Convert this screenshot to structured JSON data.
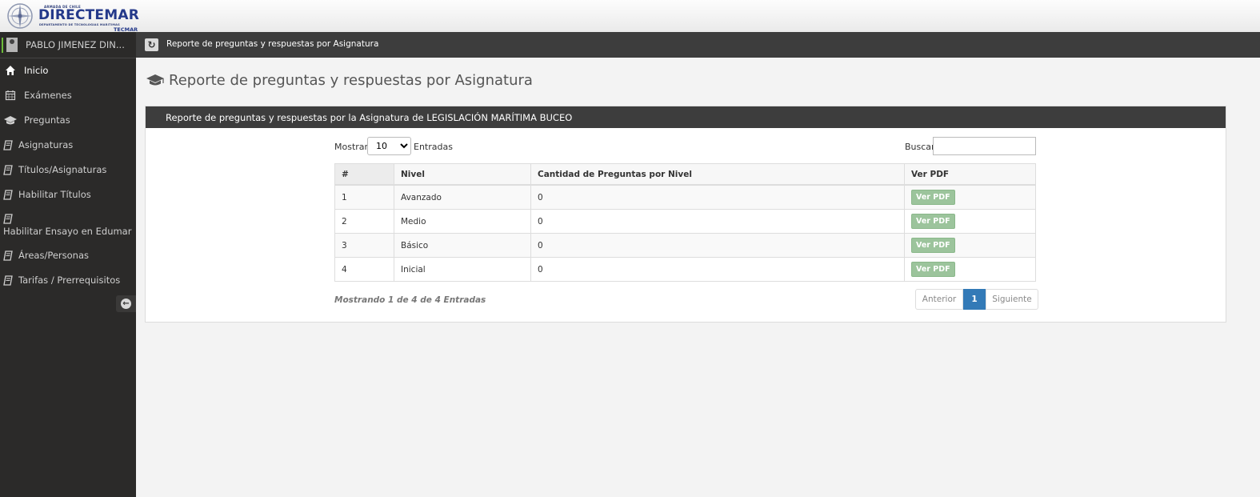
{
  "logo": {
    "top_text": "ARMADA DE CHILE",
    "brand": "DIRECTEMAR",
    "department": "DEPARTAMENTO DE TECNOLOGIAS MARITIMAS",
    "suffix": "TECMAR"
  },
  "user": {
    "name": "PABLO JIMENEZ DIN..."
  },
  "sidebar": {
    "items": [
      {
        "label": "Inicio",
        "icon": "home-icon",
        "active": true
      },
      {
        "label": "Exámenes",
        "icon": "calendar-icon"
      },
      {
        "label": "Preguntas",
        "icon": "graduation-cap-icon"
      },
      {
        "label": "Asignaturas",
        "icon": "book-icon"
      },
      {
        "label": "Títulos/Asignaturas",
        "icon": "book-icon"
      },
      {
        "label": "Habilitar Títulos",
        "icon": "book-icon"
      },
      {
        "label": "Habilitar Ensayo en Edumar",
        "icon": "book-icon"
      },
      {
        "label": "Áreas/Personas",
        "icon": "book-icon"
      },
      {
        "label": "Tarifas / Prerrequisitos",
        "icon": "book-icon"
      }
    ]
  },
  "breadcrumb": {
    "label": "Reporte de preguntas y respuestas por Asignatura"
  },
  "page": {
    "title": "Reporte de preguntas y respuestas por Asignatura"
  },
  "panel": {
    "title": "Reporte de preguntas y respuestas por la Asignatura de LEGISLACIÓN MARÍTIMA BUCEO",
    "length": {
      "prefix": "Mostrar",
      "value": "10",
      "suffix": "Entradas"
    },
    "search": {
      "label": "Buscar:",
      "value": ""
    },
    "columns": [
      "#",
      "Nivel",
      "Cantidad de Preguntas por Nivel",
      "Ver PDF"
    ],
    "rows": [
      {
        "num": "1",
        "nivel": "Avanzado",
        "cantidad": "0",
        "pdf": "Ver PDF"
      },
      {
        "num": "2",
        "nivel": "Medio",
        "cantidad": "0",
        "pdf": "Ver PDF"
      },
      {
        "num": "3",
        "nivel": "Básico",
        "cantidad": "0",
        "pdf": "Ver PDF"
      },
      {
        "num": "4",
        "nivel": "Inicial",
        "cantidad": "0",
        "pdf": "Ver PDF"
      }
    ],
    "info": "Mostrando 1 de 4 de 4 Entradas",
    "pager": {
      "prev": "Anterior",
      "current": "1",
      "next": "Siguiente"
    }
  },
  "colors": {
    "sidebar_bg": "#2b2a29",
    "header_bar": "#3d3d3d",
    "accent_green": "#6dbb3a",
    "pdf_button": "#9cc49c",
    "pager_active": "#337ab7",
    "brand_blue": "#24398a"
  }
}
